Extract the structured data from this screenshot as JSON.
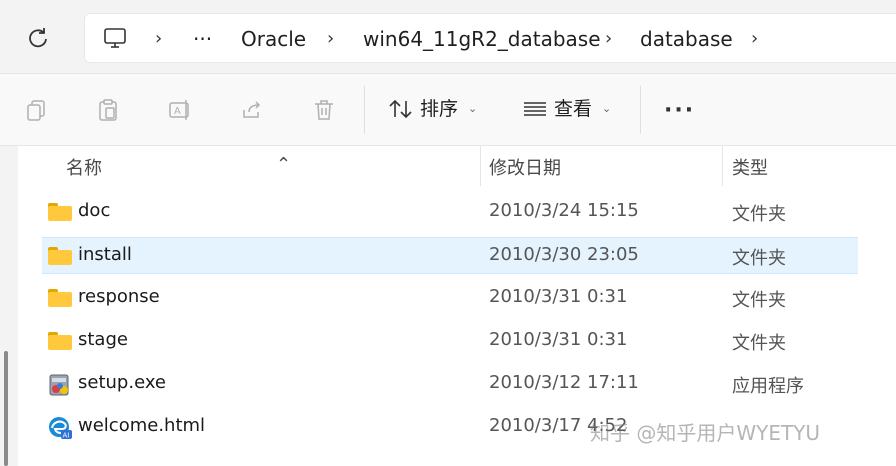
{
  "address_bar": {
    "more_label": "···",
    "breadcrumb": [
      "Oracle",
      "win64_11gR2_database",
      "database"
    ]
  },
  "command_bar": {
    "sort_label": "排序",
    "view_label": "查看",
    "more_label": "···"
  },
  "columns": {
    "name": "名称",
    "modified": "修改日期",
    "type": "类型"
  },
  "files": [
    {
      "name": "doc",
      "modified": "2010/3/24 15:15",
      "type": "文件夹",
      "icon": "folder-icon"
    },
    {
      "name": "install",
      "modified": "2010/3/30 23:05",
      "type": "文件夹",
      "icon": "folder-icon",
      "selected": true
    },
    {
      "name": "response",
      "modified": "2010/3/31 0:31",
      "type": "文件夹",
      "icon": "folder-icon"
    },
    {
      "name": "stage",
      "modified": "2010/3/31 0:31",
      "type": "文件夹",
      "icon": "folder-icon"
    },
    {
      "name": "setup.exe",
      "modified": "2010/3/12 17:11",
      "type": "应用程序",
      "icon": "exe-icon"
    },
    {
      "name": "welcome.html",
      "modified": "2010/3/17 4:52",
      "type": "",
      "icon": "edge-html-icon"
    }
  ],
  "watermark": "知乎 @知乎用户WYETYU",
  "colors": {
    "selection": "#e5f3ff",
    "folder": "#ffc83d",
    "accent": "#0067c0"
  }
}
